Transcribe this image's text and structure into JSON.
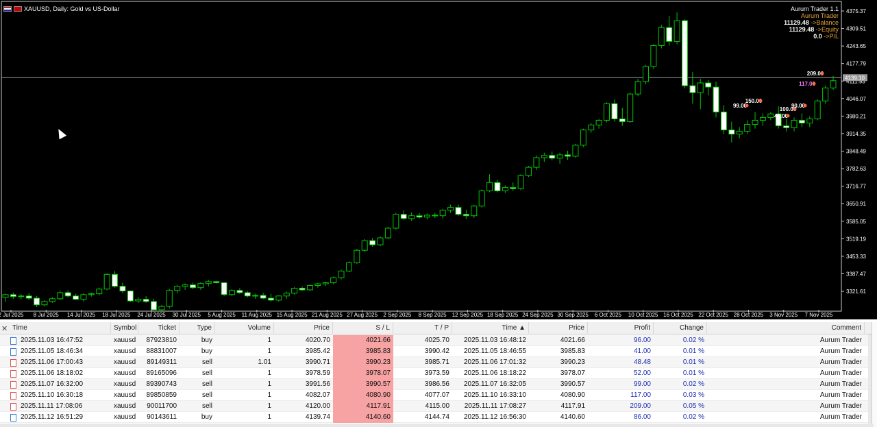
{
  "chart": {
    "symbol_title": "XAUUSD, Daily:  Gold vs US-Dollar",
    "trader": {
      "name": "Aurum Trader 1.1",
      "ea": "Aurum Trader",
      "balance": "11129.48",
      "balance_label": "->Balance",
      "equity": "11129.48",
      "equity_label": "->Equity",
      "pl": "0.0",
      "pl_label": "->P/L"
    },
    "current_price_label": "4139.10",
    "colors": {
      "background": "#000000",
      "bull": "#ffffff",
      "bear": "#000000",
      "wick": "#00c800",
      "axis_text": "#ffffff"
    }
  },
  "chart_data": {
    "type": "candlestick",
    "y_ticks": [
      "4375.37",
      "4309.51",
      "4243.65",
      "4177.79",
      "4111.93",
      "4046.07",
      "3980.21",
      "3914.35",
      "3848.49",
      "3782.63",
      "3716.77",
      "3650.91",
      "3585.05",
      "3519.19",
      "3453.33",
      "3387.47",
      "3321.61"
    ],
    "x_ticks": [
      "2 Jul 2025",
      "8 Jul 2025",
      "14 Jul 2025",
      "18 Jul 2025",
      "24 Jul 2025",
      "30 Jul 2025",
      "5 Aug 2025",
      "11 Aug 2025",
      "15 Aug 2025",
      "21 Aug 2025",
      "27 Aug 2025",
      "2 Sep 2025",
      "8 Sep 2025",
      "12 Sep 2025",
      "18 Sep 2025",
      "24 Sep 2025",
      "30 Sep 2025",
      "6 Oct 2025",
      "10 Oct 2025",
      "16 Oct 2025",
      "22 Oct 2025",
      "28 Oct 2025",
      "3 Nov 2025",
      "7 Nov 2025"
    ],
    "ylim": [
      3300,
      4390
    ],
    "candles": [
      [
        3345,
        3358,
        3330,
        3355
      ],
      [
        3355,
        3362,
        3340,
        3348
      ],
      [
        3348,
        3356,
        3338,
        3350
      ],
      [
        3350,
        3360,
        3335,
        3342
      ],
      [
        3342,
        3350,
        3310,
        3318
      ],
      [
        3318,
        3335,
        3312,
        3330
      ],
      [
        3330,
        3345,
        3325,
        3340
      ],
      [
        3340,
        3368,
        3335,
        3362
      ],
      [
        3362,
        3370,
        3345,
        3350
      ],
      [
        3350,
        3358,
        3335,
        3338
      ],
      [
        3338,
        3360,
        3330,
        3355
      ],
      [
        3355,
        3362,
        3348,
        3358
      ],
      [
        3358,
        3380,
        3352,
        3375
      ],
      [
        3375,
        3432,
        3370,
        3428
      ],
      [
        3428,
        3440,
        3380,
        3385
      ],
      [
        3385,
        3398,
        3360,
        3368
      ],
      [
        3368,
        3370,
        3328,
        3332
      ],
      [
        3332,
        3345,
        3325,
        3338
      ],
      [
        3338,
        3350,
        3325,
        3330
      ],
      [
        3330,
        3340,
        3295,
        3300
      ],
      [
        3300,
        3318,
        3295,
        3312
      ],
      [
        3312,
        3375,
        3305,
        3370
      ],
      [
        3370,
        3390,
        3360,
        3385
      ],
      [
        3385,
        3395,
        3372,
        3390
      ],
      [
        3390,
        3398,
        3375,
        3380
      ],
      [
        3380,
        3400,
        3372,
        3395
      ],
      [
        3395,
        3408,
        3385,
        3402
      ],
      [
        3402,
        3405,
        3395,
        3398
      ],
      [
        3398,
        3400,
        3350,
        3355
      ],
      [
        3355,
        3375,
        3350,
        3370
      ],
      [
        3370,
        3378,
        3358,
        3362
      ],
      [
        3362,
        3368,
        3345,
        3350
      ],
      [
        3350,
        3358,
        3340,
        3352
      ],
      [
        3352,
        3362,
        3338,
        3342
      ],
      [
        3342,
        3358,
        3330,
        3335
      ],
      [
        3335,
        3352,
        3330,
        3350
      ],
      [
        3350,
        3366,
        3340,
        3360
      ],
      [
        3360,
        3382,
        3355,
        3378
      ],
      [
        3378,
        3385,
        3368,
        3372
      ],
      [
        3372,
        3392,
        3368,
        3388
      ],
      [
        3388,
        3398,
        3380,
        3394
      ],
      [
        3394,
        3402,
        3386,
        3398
      ],
      [
        3398,
        3420,
        3392,
        3416
      ],
      [
        3416,
        3445,
        3410,
        3440
      ],
      [
        3440,
        3475,
        3436,
        3470
      ],
      [
        3470,
        3520,
        3466,
        3515
      ],
      [
        3515,
        3555,
        3510,
        3550
      ],
      [
        3550,
        3560,
        3528,
        3535
      ],
      [
        3535,
        3565,
        3530,
        3560
      ],
      [
        3560,
        3600,
        3555,
        3595
      ],
      [
        3595,
        3650,
        3590,
        3645
      ],
      [
        3645,
        3660,
        3625,
        3630
      ],
      [
        3630,
        3652,
        3622,
        3640
      ],
      [
        3640,
        3650,
        3630,
        3635
      ],
      [
        3635,
        3648,
        3626,
        3642
      ],
      [
        3642,
        3650,
        3632,
        3640
      ],
      [
        3640,
        3665,
        3630,
        3660
      ],
      [
        3660,
        3680,
        3650,
        3670
      ],
      [
        3670,
        3680,
        3640,
        3645
      ],
      [
        3645,
        3662,
        3628,
        3640
      ],
      [
        3640,
        3680,
        3632,
        3675
      ],
      [
        3675,
        3735,
        3670,
        3730
      ],
      [
        3730,
        3790,
        3725,
        3760
      ],
      [
        3760,
        3770,
        3725,
        3730
      ],
      [
        3730,
        3750,
        3722,
        3742
      ],
      [
        3742,
        3760,
        3730,
        3738
      ],
      [
        3738,
        3790,
        3732,
        3785
      ],
      [
        3785,
        3820,
        3780,
        3815
      ],
      [
        3815,
        3858,
        3805,
        3850
      ],
      [
        3850,
        3868,
        3835,
        3858
      ],
      [
        3858,
        3872,
        3840,
        3848
      ],
      [
        3848,
        3868,
        3828,
        3860
      ],
      [
        3860,
        3875,
        3842,
        3855
      ],
      [
        3855,
        3900,
        3850,
        3895
      ],
      [
        3895,
        3955,
        3888,
        3950
      ],
      [
        3950,
        3975,
        3940,
        3968
      ],
      [
        3968,
        3990,
        3955,
        3985
      ],
      [
        3985,
        4050,
        3978,
        4045
      ],
      [
        4045,
        4060,
        3980,
        3990
      ],
      [
        3990,
        4030,
        3965,
        3980
      ],
      [
        3980,
        4085,
        3975,
        4080
      ],
      [
        4080,
        4135,
        4072,
        4125
      ],
      [
        4125,
        4185,
        4115,
        4180
      ],
      [
        4180,
        4260,
        4170,
        4255
      ],
      [
        4255,
        4330,
        4245,
        4320
      ],
      [
        4320,
        4362,
        4255,
        4270
      ],
      [
        4270,
        4375,
        4260,
        4345
      ],
      [
        4345,
        4350,
        4100,
        4110
      ],
      [
        4110,
        4160,
        4045,
        4085
      ],
      [
        4085,
        4135,
        4025,
        4120
      ],
      [
        4120,
        4130,
        4075,
        4105
      ],
      [
        4105,
        4125,
        3995,
        4015
      ],
      [
        4015,
        4040,
        3935,
        3950
      ],
      [
        3950,
        3980,
        3905,
        3935
      ],
      [
        3935,
        3960,
        3920,
        3945
      ],
      [
        3945,
        3985,
        3935,
        3970
      ],
      [
        3970,
        4015,
        3955,
        3985
      ],
      [
        3985,
        4010,
        3965,
        3995
      ],
      [
        3995,
        4015,
        3985,
        4008
      ],
      [
        4008,
        4035,
        3955,
        3965
      ],
      [
        3965,
        3990,
        3945,
        3958
      ],
      [
        3958,
        3995,
        3945,
        3985
      ],
      [
        3985,
        4010,
        3960,
        3975
      ],
      [
        3975,
        4000,
        3960,
        3990
      ],
      [
        3990,
        4060,
        3985,
        4055
      ],
      [
        4055,
        4110,
        4045,
        4102
      ],
      [
        4102,
        4145,
        4095,
        4128
      ]
    ],
    "annotations": [
      "209.00",
      "117.00",
      "150.00",
      "99.00",
      "100.00",
      "90.00",
      "40.00"
    ]
  },
  "table": {
    "columns": [
      "Time",
      "Symbol",
      "Ticket",
      "Type",
      "Volume",
      "Price",
      "S / L",
      "T / P",
      "Time",
      "Price",
      "Profit",
      "Change",
      "Comment"
    ],
    "sorted_arrow": "▲",
    "rows": [
      {
        "time": "2025.11.03 16:47:52",
        "symbol": "xauusd",
        "ticket": "87923810",
        "type": "buy",
        "volume": "1",
        "price": "4020.70",
        "sl": "4021.66",
        "tp": "4025.70",
        "ctime": "2025.11.03 16:48:12",
        "cprice": "4021.66",
        "profit": "96.00",
        "change": "0.02 %",
        "comment": "Aurum Trader"
      },
      {
        "time": "2025.11.05 18:46:34",
        "symbol": "xauusd",
        "ticket": "88831007",
        "type": "buy",
        "volume": "1",
        "price": "3985.42",
        "sl": "3985.83",
        "tp": "3990.42",
        "ctime": "2025.11.05 18:46:55",
        "cprice": "3985.83",
        "profit": "41.00",
        "change": "0.01 %",
        "comment": "Aurum Trader"
      },
      {
        "time": "2025.11.06 17:00:43",
        "symbol": "xauusd",
        "ticket": "89149311",
        "type": "sell",
        "volume": "1.01",
        "price": "3990.71",
        "sl": "3990.23",
        "tp": "3985.71",
        "ctime": "2025.11.06 17:01:32",
        "cprice": "3990.23",
        "profit": "48.48",
        "change": "0.01 %",
        "comment": "Aurum Trader"
      },
      {
        "time": "2025.11.06 18:18:02",
        "symbol": "xauusd",
        "ticket": "89165096",
        "type": "sell",
        "volume": "1",
        "price": "3978.59",
        "sl": "3978.07",
        "tp": "3973.59",
        "ctime": "2025.11.06 18:18:22",
        "cprice": "3978.07",
        "profit": "52.00",
        "change": "0.01 %",
        "comment": "Aurum Trader"
      },
      {
        "time": "2025.11.07 16:32:00",
        "symbol": "xauusd",
        "ticket": "89390743",
        "type": "sell",
        "volume": "1",
        "price": "3991.56",
        "sl": "3990.57",
        "tp": "3986.56",
        "ctime": "2025.11.07 16:32:05",
        "cprice": "3990.57",
        "profit": "99.00",
        "change": "0.02 %",
        "comment": "Aurum Trader"
      },
      {
        "time": "2025.11.10 16:30:18",
        "symbol": "xauusd",
        "ticket": "89850859",
        "type": "sell",
        "volume": "1",
        "price": "4082.07",
        "sl": "4080.90",
        "tp": "4077.07",
        "ctime": "2025.11.10 16:33:10",
        "cprice": "4080.90",
        "profit": "117.00",
        "change": "0.03 %",
        "comment": "Aurum Trader"
      },
      {
        "time": "2025.11.11 17:08:06",
        "symbol": "xauusd",
        "ticket": "90011700",
        "type": "sell",
        "volume": "1",
        "price": "4120.00",
        "sl": "4117.91",
        "tp": "4115.00",
        "ctime": "2025.11.11 17:08:27",
        "cprice": "4117.91",
        "profit": "209.00",
        "change": "0.05 %",
        "comment": "Aurum Trader"
      },
      {
        "time": "2025.11.12 16:51:29",
        "symbol": "xauusd",
        "ticket": "90143611",
        "type": "buy",
        "volume": "1",
        "price": "4139.74",
        "sl": "4140.60",
        "tp": "4144.74",
        "ctime": "2025.11.12 16:56:30",
        "cprice": "4140.60",
        "profit": "86.00",
        "change": "0.02 %",
        "comment": "Aurum Trader"
      }
    ]
  }
}
